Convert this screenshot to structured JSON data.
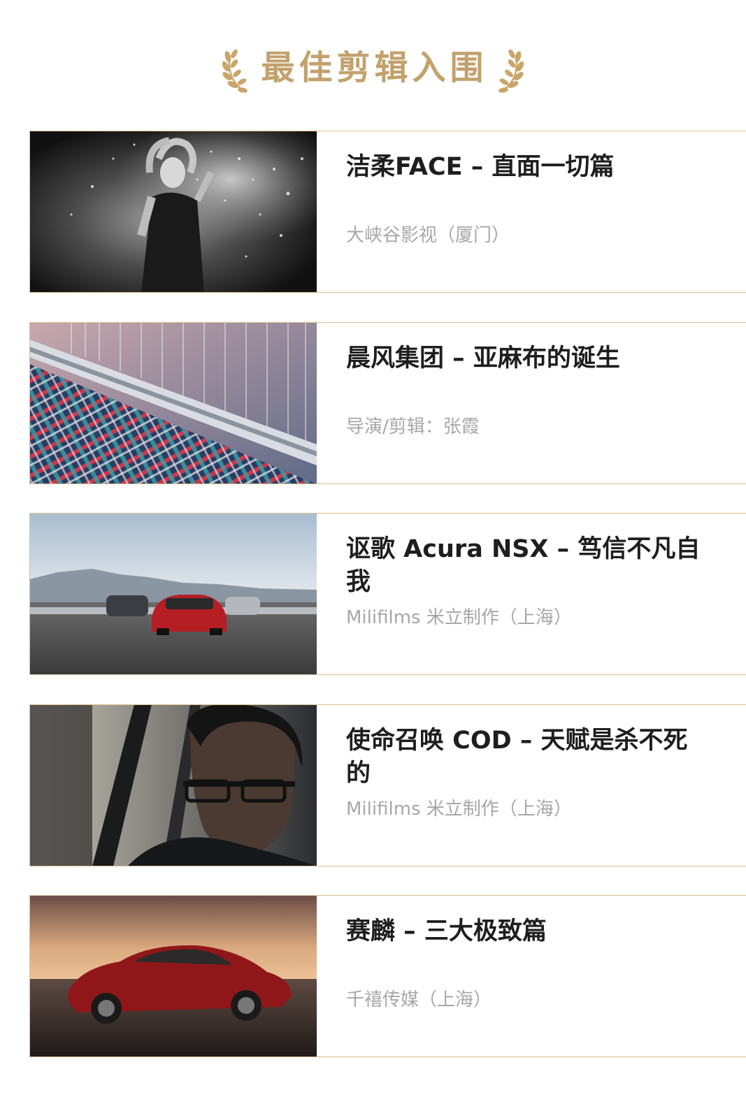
{
  "header": {
    "title": "最佳剪辑入围",
    "icon": "laurel-wreath-icon",
    "accent_color": "#c2a16d"
  },
  "card_border_color": "#d9bf91",
  "nominees": [
    {
      "title": "洁柔FACE – 直面一切篇",
      "subtitle": "大峡谷影视（厦门）",
      "thumbnail": "woman-water-splash-bw"
    },
    {
      "title": "晨风集团 – 亚麻布的诞生",
      "subtitle": "导演/剪辑：张霞",
      "thumbnail": "loom-plaid-fabric"
    },
    {
      "title": "讴歌 Acura NSX – 笃信不凡自我",
      "subtitle": "Milifilms 米立制作（上海）",
      "thumbnail": "acura-cars-on-track"
    },
    {
      "title": "使命召唤 COD – 天赋是杀不死的",
      "subtitle": "Milifilms 米立制作（上海）",
      "thumbnail": "man-with-glasses-in-car"
    },
    {
      "title": "赛麟 – 三大极致篇",
      "subtitle": "千禧传媒（上海）",
      "thumbnail": "red-sports-car-sunset"
    }
  ]
}
